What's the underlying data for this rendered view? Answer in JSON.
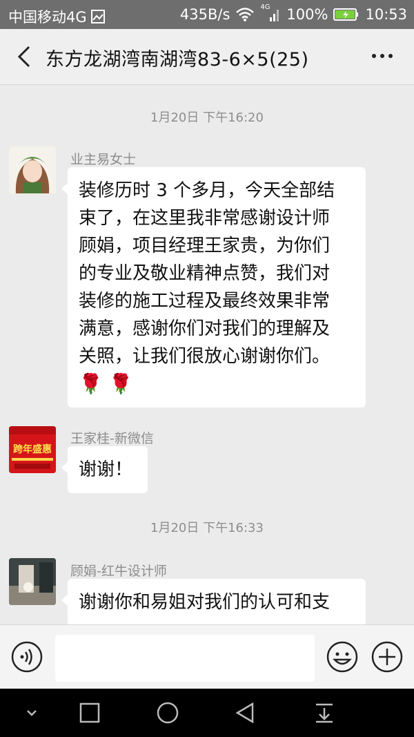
{
  "status_bar": {
    "carrier": "中国移动4G",
    "speed": "435B/s",
    "network": "4G",
    "battery": "100%",
    "time": "10:53"
  },
  "header": {
    "title": "东方龙湖湾南湖湾83-6×5(25)"
  },
  "messages": [
    {
      "type": "time",
      "text": "1月20日 下午16:20"
    },
    {
      "type": "msg",
      "sender": "业主易女士",
      "lines": [
        "装修历时 3 个多月，今天全部结",
        "束了，在这里我非常感谢设计师",
        "顾娟，项目经理王家贵，为你们",
        "的专业及敬业精神点赞，我们对",
        "装修的施工过程及最终效果非常",
        "满意，感谢你们对我们的理解及",
        "关照，让我们很放心谢谢你们。"
      ],
      "emoji": "🌹 🌹"
    },
    {
      "type": "msg",
      "sender": "王家桂-新微信",
      "lines": [
        "谢谢！"
      ]
    },
    {
      "type": "time",
      "text": "1月20日 下午16:33"
    },
    {
      "type": "msg",
      "sender": "顾娟-红牛设计师",
      "lines": [
        "谢谢你和易姐对我们的认可和支"
      ]
    }
  ],
  "avatar2_text": "跨年盛惠",
  "input_bar": {
    "placeholder": ""
  },
  "colors": {
    "bg": "#ebebeb",
    "bubble": "#ffffff",
    "statusbar": "#6e6e6e"
  },
  "icons": [
    "back-icon",
    "more-icon",
    "voice-icon",
    "emoji-icon",
    "plus-icon",
    "nav-down-icon",
    "nav-square-icon",
    "nav-home-icon",
    "nav-back-icon",
    "nav-notification-icon"
  ]
}
